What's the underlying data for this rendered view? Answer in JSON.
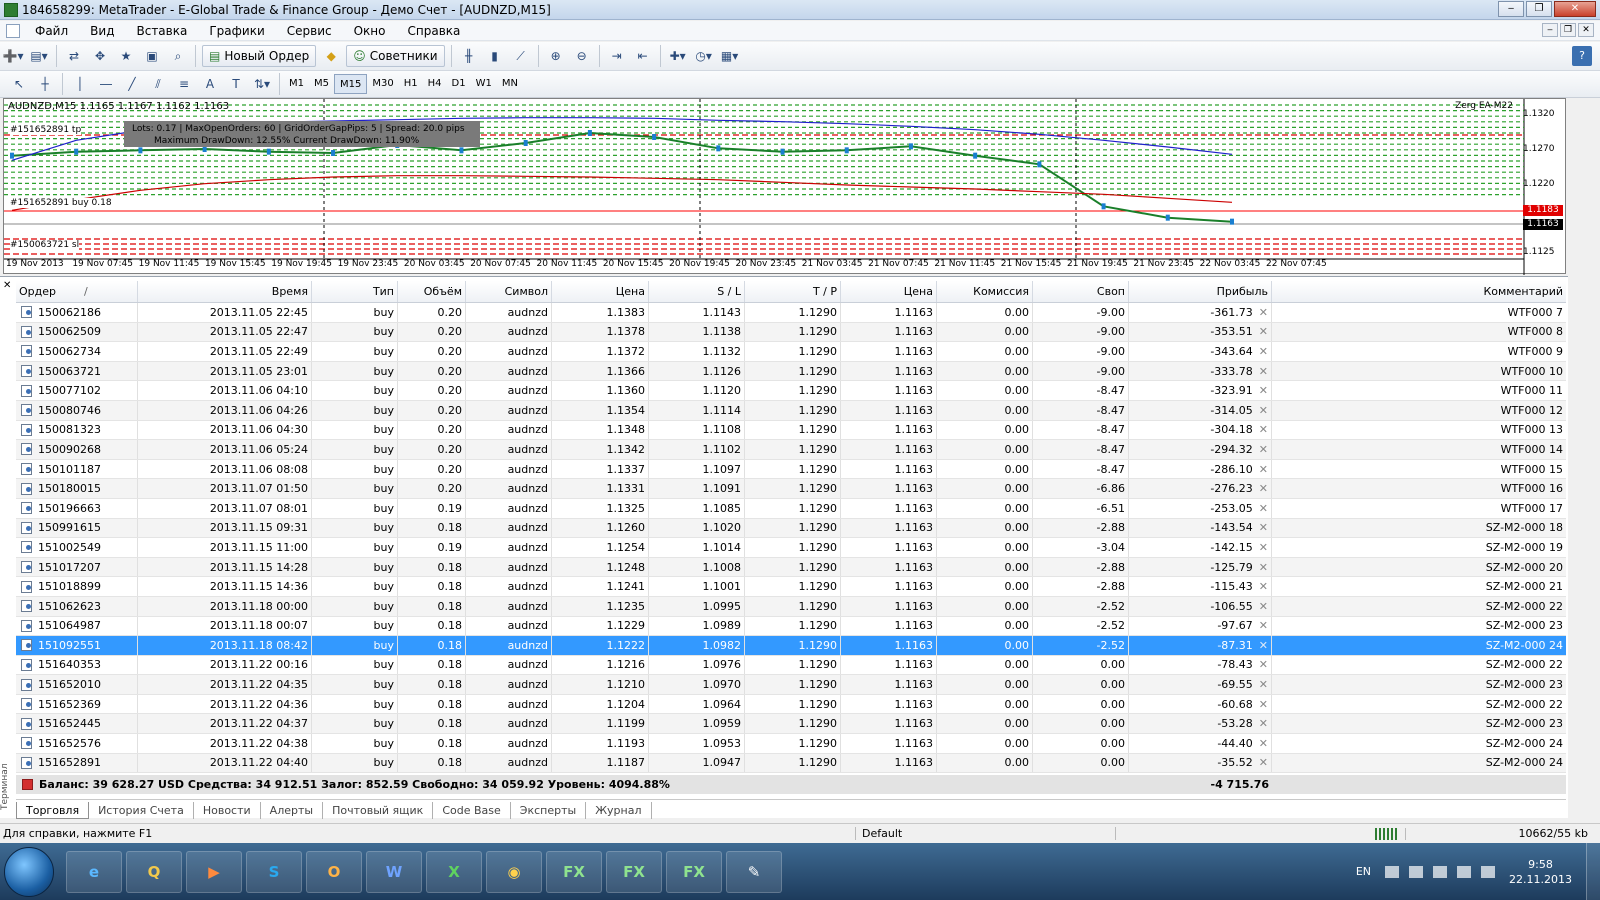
{
  "window": {
    "title": "184658299: MetaTrader - E-Global Trade & Finance Group - Демо Счет - [AUDNZD,M15]"
  },
  "menu": [
    "Файл",
    "Вид",
    "Вставка",
    "Графики",
    "Сервис",
    "Окно",
    "Справка"
  ],
  "toolbar": {
    "new_order": "Новый Ордер",
    "experts": "Советники"
  },
  "timeframes": [
    "M1",
    "M5",
    "M15",
    "M30",
    "H1",
    "H4",
    "D1",
    "W1",
    "MN"
  ],
  "selected_timeframe": "M15",
  "chart": {
    "header": "AUDNZD,M15  1.1165 1.1167 1.1162 1.1163",
    "ea_label": "Zerg EA-M22",
    "info_line1": "Lots: 0.17   |   MaxOpenOrders: 60   |   GridOrderGapPips: 5   |   Spread: 20.0 pips",
    "info_line2": "Maximum DrawDown: 12.55%          Current DrawDown: 11.90%",
    "order_tags": [
      "#151652891 tp",
      "#151652891 buy 0.18",
      "#150063721 sl"
    ],
    "price_labels": [
      "1.1320",
      "1.1270",
      "1.1220",
      "1.1175",
      "1.1125"
    ],
    "price_tags": {
      "red": "1.1183",
      "black": "1.1163"
    },
    "time_labels": [
      "19 Nov 2013",
      "19 Nov 07:45",
      "19 Nov 11:45",
      "19 Nov 15:45",
      "19 Nov 19:45",
      "19 Nov 23:45",
      "20 Nov 03:45",
      "20 Nov 07:45",
      "20 Nov 11:45",
      "20 Nov 15:45",
      "20 Nov 19:45",
      "20 Nov 23:45",
      "21 Nov 03:45",
      "21 Nov 07:45",
      "21 Nov 11:45",
      "21 Nov 15:45",
      "21 Nov 19:45",
      "21 Nov 23:45",
      "22 Nov 03:45",
      "22 Nov 07:45"
    ]
  },
  "chart_data": {
    "type": "line",
    "title": "AUDNZD,M15",
    "ohlc_last": {
      "open": 1.1165,
      "high": 1.1167,
      "low": 1.1162,
      "close": 1.1163
    },
    "x": [
      "19 Nov 2013",
      "19 Nov 07:45",
      "19 Nov 11:45",
      "19 Nov 15:45",
      "19 Nov 19:45",
      "19 Nov 23:45",
      "20 Nov 03:45",
      "20 Nov 07:45",
      "20 Nov 11:45",
      "20 Nov 15:45",
      "20 Nov 19:45",
      "20 Nov 23:45",
      "21 Nov 03:45",
      "21 Nov 07:45",
      "21 Nov 11:45",
      "21 Nov 15:45",
      "21 Nov 19:45",
      "21 Nov 23:45",
      "22 Nov 03:45",
      "22 Nov 07:45"
    ],
    "series": [
      {
        "values": [
          1.1262,
          1.1268,
          1.127,
          1.1272,
          1.1268,
          1.1266,
          1.1278,
          1.127,
          1.1281,
          1.1296,
          1.129,
          1.1273,
          1.1268,
          1.127,
          1.1276,
          1.1262,
          1.1249,
          1.1186,
          1.1169,
          1.1163
        ]
      },
      {
        "values": [
          1.1255,
          1.1285,
          1.13,
          1.1308,
          1.1312,
          1.1314,
          1.1316,
          1.1318,
          1.1319,
          1.1319,
          1.1318,
          1.1315,
          1.1313,
          1.131,
          1.1306,
          1.1301,
          1.1294,
          1.1285,
          1.1275,
          1.1264
        ]
      },
      {
        "values": [
          1.118,
          1.1196,
          1.121,
          1.122,
          1.1226,
          1.123,
          1.1232,
          1.1232,
          1.1231,
          1.123,
          1.1228,
          1.1226,
          1.1222,
          1.1218,
          1.1215,
          1.1212,
          1.1208,
          1.1204,
          1.1198,
          1.1192
        ]
      }
    ],
    "ylim": [
      1.111,
      1.1335
    ],
    "grid": false
  },
  "terminal": {
    "columns": [
      "Ордер",
      "Время",
      "Тип",
      "Объём",
      "Символ",
      "Цена",
      "S / L",
      "T / P",
      "Цена",
      "Комиссия",
      "Своп",
      "Прибыль",
      "Комментарий"
    ],
    "rows": [
      [
        "150062186",
        "2013.11.05 22:45",
        "buy",
        "0.20",
        "audnzd",
        "1.1383",
        "1.1143",
        "1.1290",
        "1.1163",
        "0.00",
        "-9.00",
        "-361.73",
        "WTF000 7"
      ],
      [
        "150062509",
        "2013.11.05 22:47",
        "buy",
        "0.20",
        "audnzd",
        "1.1378",
        "1.1138",
        "1.1290",
        "1.1163",
        "0.00",
        "-9.00",
        "-353.51",
        "WTF000 8"
      ],
      [
        "150062734",
        "2013.11.05 22:49",
        "buy",
        "0.20",
        "audnzd",
        "1.1372",
        "1.1132",
        "1.1290",
        "1.1163",
        "0.00",
        "-9.00",
        "-343.64",
        "WTF000 9"
      ],
      [
        "150063721",
        "2013.11.05 23:01",
        "buy",
        "0.20",
        "audnzd",
        "1.1366",
        "1.1126",
        "1.1290",
        "1.1163",
        "0.00",
        "-9.00",
        "-333.78",
        "WTF000 10"
      ],
      [
        "150077102",
        "2013.11.06 04:10",
        "buy",
        "0.20",
        "audnzd",
        "1.1360",
        "1.1120",
        "1.1290",
        "1.1163",
        "0.00",
        "-8.47",
        "-323.91",
        "WTF000 11"
      ],
      [
        "150080746",
        "2013.11.06 04:26",
        "buy",
        "0.20",
        "audnzd",
        "1.1354",
        "1.1114",
        "1.1290",
        "1.1163",
        "0.00",
        "-8.47",
        "-314.05",
        "WTF000 12"
      ],
      [
        "150081323",
        "2013.11.06 04:30",
        "buy",
        "0.20",
        "audnzd",
        "1.1348",
        "1.1108",
        "1.1290",
        "1.1163",
        "0.00",
        "-8.47",
        "-304.18",
        "WTF000 13"
      ],
      [
        "150090268",
        "2013.11.06 05:24",
        "buy",
        "0.20",
        "audnzd",
        "1.1342",
        "1.1102",
        "1.1290",
        "1.1163",
        "0.00",
        "-8.47",
        "-294.32",
        "WTF000 14"
      ],
      [
        "150101187",
        "2013.11.06 08:08",
        "buy",
        "0.20",
        "audnzd",
        "1.1337",
        "1.1097",
        "1.1290",
        "1.1163",
        "0.00",
        "-8.47",
        "-286.10",
        "WTF000 15"
      ],
      [
        "150180015",
        "2013.11.07 01:50",
        "buy",
        "0.20",
        "audnzd",
        "1.1331",
        "1.1091",
        "1.1290",
        "1.1163",
        "0.00",
        "-6.86",
        "-276.23",
        "WTF000 16"
      ],
      [
        "150196663",
        "2013.11.07 08:01",
        "buy",
        "0.19",
        "audnzd",
        "1.1325",
        "1.1085",
        "1.1290",
        "1.1163",
        "0.00",
        "-6.51",
        "-253.05",
        "WTF000 17"
      ],
      [
        "150991615",
        "2013.11.15 09:31",
        "buy",
        "0.18",
        "audnzd",
        "1.1260",
        "1.1020",
        "1.1290",
        "1.1163",
        "0.00",
        "-2.88",
        "-143.54",
        "SZ-M2-000 18"
      ],
      [
        "151002549",
        "2013.11.15 11:00",
        "buy",
        "0.19",
        "audnzd",
        "1.1254",
        "1.1014",
        "1.1290",
        "1.1163",
        "0.00",
        "-3.04",
        "-142.15",
        "SZ-M2-000 19"
      ],
      [
        "151017207",
        "2013.11.15 14:28",
        "buy",
        "0.18",
        "audnzd",
        "1.1248",
        "1.1008",
        "1.1290",
        "1.1163",
        "0.00",
        "-2.88",
        "-125.79",
        "SZ-M2-000 20"
      ],
      [
        "151018899",
        "2013.11.15 14:36",
        "buy",
        "0.18",
        "audnzd",
        "1.1241",
        "1.1001",
        "1.1290",
        "1.1163",
        "0.00",
        "-2.88",
        "-115.43",
        "SZ-M2-000 21"
      ],
      [
        "151062623",
        "2013.11.18 00:00",
        "buy",
        "0.18",
        "audnzd",
        "1.1235",
        "1.0995",
        "1.1290",
        "1.1163",
        "0.00",
        "-2.52",
        "-106.55",
        "SZ-M2-000 22"
      ],
      [
        "151064987",
        "2013.11.18 00:07",
        "buy",
        "0.18",
        "audnzd",
        "1.1229",
        "1.0989",
        "1.1290",
        "1.1163",
        "0.00",
        "-2.52",
        "-97.67",
        "SZ-M2-000 23"
      ],
      [
        "151092551",
        "2013.11.18 08:42",
        "buy",
        "0.18",
        "audnzd",
        "1.1222",
        "1.0982",
        "1.1290",
        "1.1163",
        "0.00",
        "-2.52",
        "-87.31",
        "SZ-M2-000 24"
      ],
      [
        "151640353",
        "2013.11.22 00:16",
        "buy",
        "0.18",
        "audnzd",
        "1.1216",
        "1.0976",
        "1.1290",
        "1.1163",
        "0.00",
        "0.00",
        "-78.43",
        "SZ-M2-000 22"
      ],
      [
        "151652010",
        "2013.11.22 04:35",
        "buy",
        "0.18",
        "audnzd",
        "1.1210",
        "1.0970",
        "1.1290",
        "1.1163",
        "0.00",
        "0.00",
        "-69.55",
        "SZ-M2-000 23"
      ],
      [
        "151652369",
        "2013.11.22 04:36",
        "buy",
        "0.18",
        "audnzd",
        "1.1204",
        "1.0964",
        "1.1290",
        "1.1163",
        "0.00",
        "0.00",
        "-60.68",
        "SZ-M2-000 22"
      ],
      [
        "151652445",
        "2013.11.22 04:37",
        "buy",
        "0.18",
        "audnzd",
        "1.1199",
        "1.0959",
        "1.1290",
        "1.1163",
        "0.00",
        "0.00",
        "-53.28",
        "SZ-M2-000 23"
      ],
      [
        "151652576",
        "2013.11.22 04:38",
        "buy",
        "0.18",
        "audnzd",
        "1.1193",
        "1.0953",
        "1.1290",
        "1.1163",
        "0.00",
        "0.00",
        "-44.40",
        "SZ-M2-000 24"
      ],
      [
        "151652891",
        "2013.11.22 04:40",
        "buy",
        "0.18",
        "audnzd",
        "1.1187",
        "1.0947",
        "1.1290",
        "1.1163",
        "0.00",
        "0.00",
        "-35.52",
        "SZ-M2-000 24"
      ]
    ],
    "selected_order": "151092551",
    "summary": "Баланс: 39 628.27 USD  Средства: 34 912.51  Залог: 852.59  Свободно: 34 059.92  Уровень: 4094.88%",
    "summary_profit": "-4 715.76",
    "tabs": [
      "Торговля",
      "История Счета",
      "Новости",
      "Алерты",
      "Почтовый ящик",
      "Code Base",
      "Эксперты",
      "Журнал"
    ],
    "side_label": "Терминал"
  },
  "status": {
    "help": "Для справки, нажмите F1",
    "profile": "Default",
    "traffic": "10662/55 kb"
  },
  "taskbar": {
    "apps": [
      "e",
      "Q",
      "▶",
      "S",
      "O",
      "W",
      "X",
      "◉",
      "FX",
      "FX",
      "FX",
      "✎"
    ],
    "lang": "EN",
    "time": "9:58",
    "date": "22.11.2013"
  },
  "colors": {
    "selected_row": "#3399ff",
    "buy_line": "#ff0000",
    "grid_green": "#2ca02c",
    "ma_blue": "#1f1fcc",
    "ma_red": "#cc0000"
  }
}
